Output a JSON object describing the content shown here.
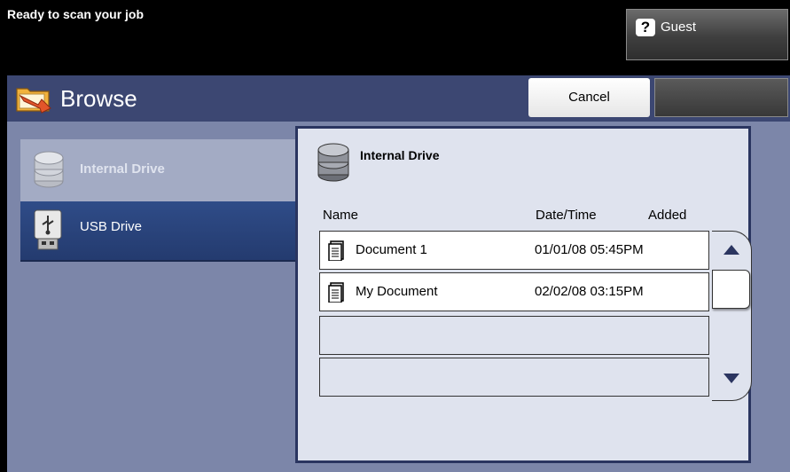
{
  "status_bar": {
    "message": "Ready to scan your job",
    "user_label": "Guest",
    "user_icon": "question-mark-icon"
  },
  "header": {
    "title": "Browse",
    "cancel_label": "Cancel"
  },
  "drives": [
    {
      "label": "Internal Drive",
      "icon": "drive-stack-icon",
      "state": "selected"
    },
    {
      "label": "USB Drive",
      "icon": "usb-drive-icon",
      "state": "available"
    }
  ],
  "content": {
    "title": "Internal Drive",
    "columns": {
      "name": "Name",
      "date": "Date/Time",
      "added": "Added"
    },
    "rows": [
      {
        "name": "Document 1",
        "date": "01/01/08 05:45PM"
      },
      {
        "name": "My Document",
        "date": "02/02/08 03:15PM"
      },
      {
        "name": "",
        "date": ""
      },
      {
        "name": "",
        "date": ""
      }
    ]
  },
  "colors": {
    "header_bg": "#3c4772",
    "panel_bg": "#7c86a9",
    "content_bg": "#dfe3ee",
    "usb_bg": "#2f4c88"
  }
}
